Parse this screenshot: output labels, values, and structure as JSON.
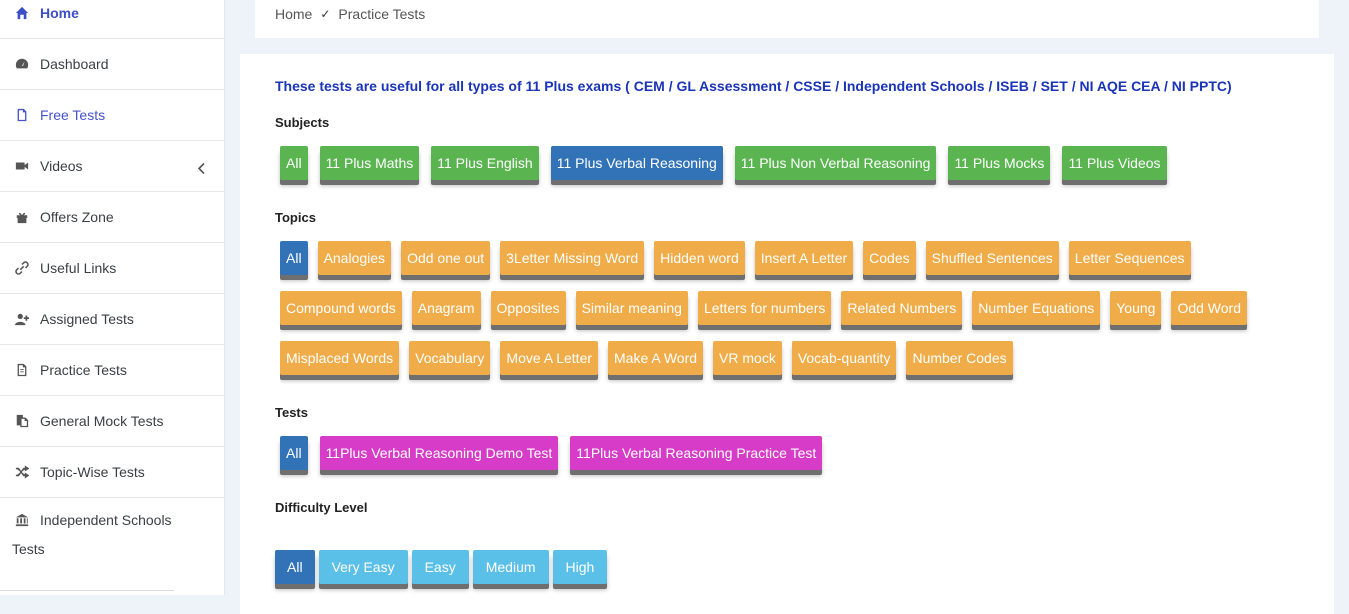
{
  "sidebar": {
    "items": [
      {
        "label": "Home",
        "icon": "home-icon"
      },
      {
        "label": "Dashboard",
        "icon": "dashboard-icon"
      },
      {
        "label": "Free Tests",
        "icon": "file-icon"
      },
      {
        "label": "Videos",
        "icon": "video-icon"
      },
      {
        "label": "Offers Zone",
        "icon": "gift-icon"
      },
      {
        "label": "Useful Links",
        "icon": "link-icon"
      },
      {
        "label": "Assigned Tests",
        "icon": "user-plus-icon"
      },
      {
        "label": "Practice Tests",
        "icon": "document-icon"
      },
      {
        "label": "General Mock Tests",
        "icon": "copy-icon"
      },
      {
        "label": "Topic-Wise Tests",
        "icon": "shuffle-icon"
      },
      {
        "label": "Independent Schools",
        "icon": "bank-icon",
        "label_line2": "Tests"
      }
    ]
  },
  "breadcrumb": {
    "home": "Home",
    "separator": "✓",
    "current": "Practice Tests"
  },
  "intro": "These tests are useful for all types of 11 Plus exams ( CEM / GL Assessment / CSSE / Independent Schools / ISEB / SET / NI AQE CEA / NI PPTC)",
  "subjects": {
    "label": "Subjects",
    "items": [
      "All",
      "11 Plus Maths",
      "11 Plus English",
      "11 Plus Verbal Reasoning",
      "11 Plus Non Verbal Reasoning",
      "11 Plus Mocks",
      "11 Plus Videos"
    ]
  },
  "topics": {
    "label": "Topics",
    "items": [
      "All",
      "Analogies",
      "Odd one out",
      "3Letter Missing Word",
      "Hidden word",
      "Insert A Letter",
      "Codes",
      "Shuffled Sentences",
      "Letter Sequences",
      "Compound words",
      "Anagram",
      "Opposites",
      "Similar meaning",
      "Letters for numbers",
      "Related Numbers",
      "Number Equations",
      "Young",
      "Odd Word",
      "Misplaced Words",
      "Vocabulary",
      "Move A Letter",
      "Make A Word",
      "VR mock",
      "Vocab-quantity",
      "Number Codes"
    ]
  },
  "tests": {
    "label": "Tests",
    "items": [
      "All",
      "11Plus Verbal Reasoning Demo Test",
      "11Plus Verbal Reasoning Practice Test"
    ]
  },
  "difficulty": {
    "label": "Difficulty Level",
    "items": [
      "All",
      "Very Easy",
      "Easy",
      "Medium",
      "High"
    ]
  },
  "colors": {
    "green": "#5ab551",
    "blue": "#3273b8",
    "orange": "#f0ac48",
    "magenta": "#d63cc8",
    "sky": "#5bc0e8",
    "intro": "#1a34b8"
  }
}
